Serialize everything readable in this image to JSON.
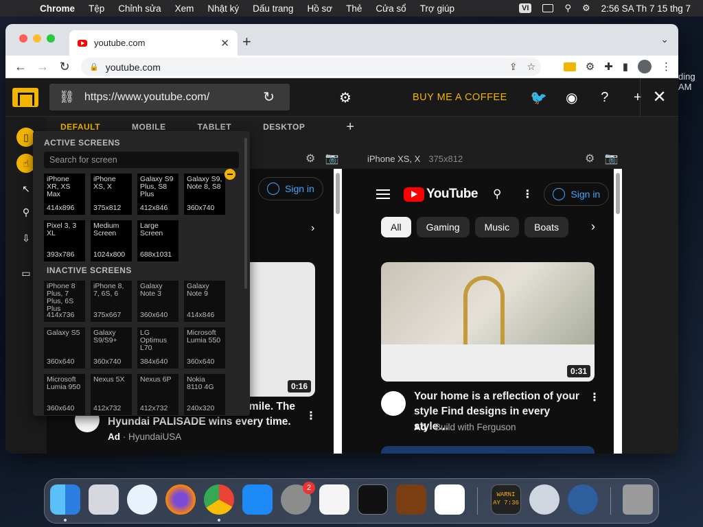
{
  "menubar": {
    "app": "Chrome",
    "items": [
      "Tệp",
      "Chỉnh sửa",
      "Xem",
      "Nhật ký",
      "Dấu trang",
      "Hồ sơ",
      "Thẻ",
      "Cửa sổ",
      "Trợ giúp"
    ],
    "input_source": "VI",
    "clock": "2:56 SA Th 7 15 thg 7"
  },
  "desktop_text": [
    "ding",
    "AM"
  ],
  "browser": {
    "tab_title": "youtube.com",
    "address": "youtube.com"
  },
  "extension": {
    "url": "https://www.youtube.com/",
    "buy_coffee": "BUY ME A COFFEE",
    "view_tabs": [
      "DEFAULT",
      "MOBILE",
      "TABLET",
      "DESKTOP"
    ],
    "active_tab": "DEFAULT",
    "add_symbol": "+"
  },
  "panel": {
    "active_title": "ACTIVE SCREENS",
    "search_placeholder": "Search for screen",
    "active_screens": [
      {
        "name": "iPhone XR, XS Max",
        "res": "414x896"
      },
      {
        "name": "iPhone XS, X",
        "res": "375x812"
      },
      {
        "name": "Galaxy S9 Plus, S8 Plus",
        "res": "412x846"
      },
      {
        "name": "Galaxy S9, Note 8, S8",
        "res": "360x740"
      },
      {
        "name": "Pixel 3, 3 XL",
        "res": "393x786"
      },
      {
        "name": "Medium Screen",
        "res": "1024x800"
      },
      {
        "name": "Large Screen",
        "res": "688x1031"
      }
    ],
    "inactive_title": "INACTIVE SCREENS",
    "inactive_screens": [
      {
        "name": "iPhone 8 Plus, 7 Plus, 6S Plus",
        "res": "414x736"
      },
      {
        "name": "iPhone 8, 7, 6S, 6",
        "res": "375x667"
      },
      {
        "name": "Galaxy Note 3",
        "res": "360x640"
      },
      {
        "name": "Galaxy Note 9",
        "res": "414x846"
      },
      {
        "name": "Galaxy S5",
        "res": "360x640"
      },
      {
        "name": "Galaxy S9/S9+",
        "res": "360x740"
      },
      {
        "name": "LG Optimus L70",
        "res": "384x640"
      },
      {
        "name": "Microsoft Lumia 550",
        "res": "360x640"
      },
      {
        "name": "Microsoft Lumia 950",
        "res": "360x640"
      },
      {
        "name": "Nexus 5X",
        "res": "412x732"
      },
      {
        "name": "Nexus 6P",
        "res": "412x732"
      },
      {
        "name": "Nokia 8110 4G",
        "res": "240x320"
      }
    ]
  },
  "device_left": {
    "signin": "Sign in",
    "duration": "0:16",
    "title_partial": "We're thinking of you every mile. The Hyundai PALISADE wins every time.",
    "ad": "Ad",
    "channel": "HyundaiUSA"
  },
  "device_right": {
    "name": "iPhone XS, X",
    "res": "375x812",
    "logo": "YouTube",
    "signin": "Sign in",
    "chips": [
      "All",
      "Gaming",
      "Music",
      "Boats"
    ],
    "duration": "0:31",
    "title": "Your home is a reflection of your style Find designs in every style…",
    "ad": "Ad",
    "channel": "Build with Ferguson"
  },
  "dock": {
    "settings_badge": "2",
    "console_label": "WARNI AY 7:36"
  }
}
